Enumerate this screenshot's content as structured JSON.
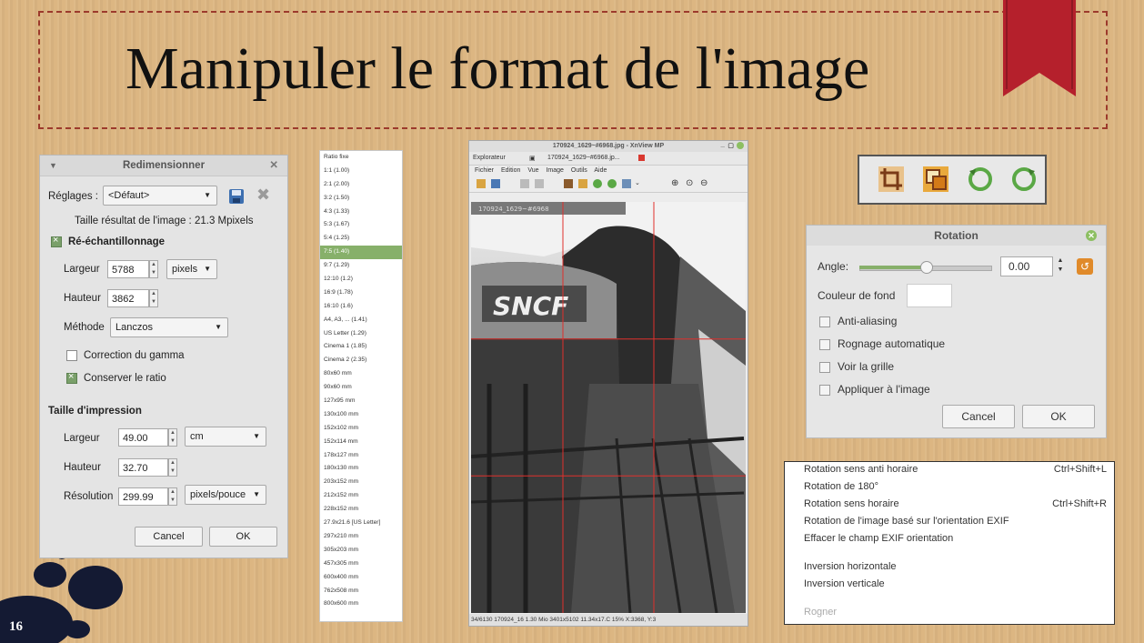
{
  "slide": {
    "title": "Manipuler le format de l'image",
    "page_number": "16"
  },
  "resize_dialog": {
    "title": "Redimensionner",
    "presets_label": "Réglages :",
    "presets_value": "<Défaut>",
    "result_size": "Taille résultat de l'image : 21.3 Mpixels",
    "resample_label": "Ré-échantillonnage",
    "width_label": "Largeur",
    "width_value": "5788",
    "height_label": "Hauteur",
    "height_value": "3862",
    "unit_value": "pixels",
    "method_label": "Méthode",
    "method_value": "Lanczos",
    "gamma_label": "Correction du gamma",
    "ratio_label": "Conserver le ratio",
    "print_section": "Taille d'impression",
    "print_width_label": "Largeur",
    "print_width_value": "49.00",
    "print_unit": "cm",
    "print_height_label": "Hauteur",
    "print_height_value": "32.70",
    "resolution_label": "Résolution",
    "resolution_value": "299.99",
    "resolution_unit": "pixels/pouce",
    "cancel_label": "Cancel",
    "ok_label": "OK"
  },
  "ratio_list": {
    "items": [
      "Ratio fixe",
      "1:1 (1.00)",
      "2:1 (2.00)",
      "3:2 (1.50)",
      "4:3 (1.33)",
      "5:3 (1.67)",
      "5:4 (1.25)",
      "7:5 (1.40)",
      "9:7 (1.29)",
      "12:10 (1.2)",
      "16:9 (1.78)",
      "16:10 (1.6)",
      "A4, A3, ... (1.41)",
      "US Letter (1.29)",
      "Cinema 1 (1.85)",
      "Cinema 2 (2.35)",
      "80x60 mm",
      "90x60 mm",
      "127x95 mm",
      "130x100 mm",
      "152x102 mm",
      "152x114 mm",
      "178x127 mm",
      "180x130 mm",
      "203x152 mm",
      "212x152 mm",
      "228x152 mm",
      "27.9x21.6 [US Letter]",
      "297x210 mm",
      "305x203 mm",
      "457x305 mm",
      "600x400 mm",
      "762x508 mm",
      "800x600 mm"
    ],
    "selected_index": 7
  },
  "xnview": {
    "window_title": "170924_1629~#6968.jpg - XnView MP",
    "tab_explorer": "Explorateur",
    "tab_file": "170924_1629~#6968.jp...",
    "menu": [
      "Fichier",
      "Edition",
      "Vue",
      "Image",
      "Outils",
      "Aide"
    ],
    "photo_sign": "SNCF",
    "photo_caption": "170924_1629~#6968",
    "status": "34/6130  170924_16  1.30 Mio  3401x5102  11.34x17.C  15%  X:3368, Y:3"
  },
  "icon_toolbar": {
    "icons": [
      "crop-icon",
      "resize-icon",
      "rotate-left-icon",
      "rotate-right-icon"
    ]
  },
  "rotation_dialog": {
    "title": "Rotation",
    "angle_label": "Angle:",
    "angle_value": "0.00",
    "bg_color_label": "Couleur de fond",
    "antialias_label": "Anti-aliasing",
    "autocrop_label": "Rognage automatique",
    "grid_label": "Voir la grille",
    "apply_label": "Appliquer à l'image",
    "cancel_label": "Cancel",
    "ok_label": "OK"
  },
  "rotation_menu": {
    "items": [
      {
        "label": "Rotation sens anti horaire",
        "shortcut": "Ctrl+Shift+L"
      },
      {
        "label": "Rotation de 180°",
        "shortcut": ""
      },
      {
        "label": "Rotation sens horaire",
        "shortcut": "Ctrl+Shift+R"
      },
      {
        "label": "Rotation de l'image basé sur l'orientation EXIF",
        "shortcut": ""
      },
      {
        "label": "Effacer le champ EXIF orientation",
        "shortcut": ""
      },
      {
        "label": "Inversion horizontale",
        "shortcut": ""
      },
      {
        "label": "Inversion verticale",
        "shortcut": ""
      },
      {
        "label": "Rogner",
        "shortcut": ""
      }
    ]
  },
  "colors": {
    "ribbon": "#b5202c",
    "frame": "#9c3a2c",
    "accent_green": "#87b06a"
  }
}
